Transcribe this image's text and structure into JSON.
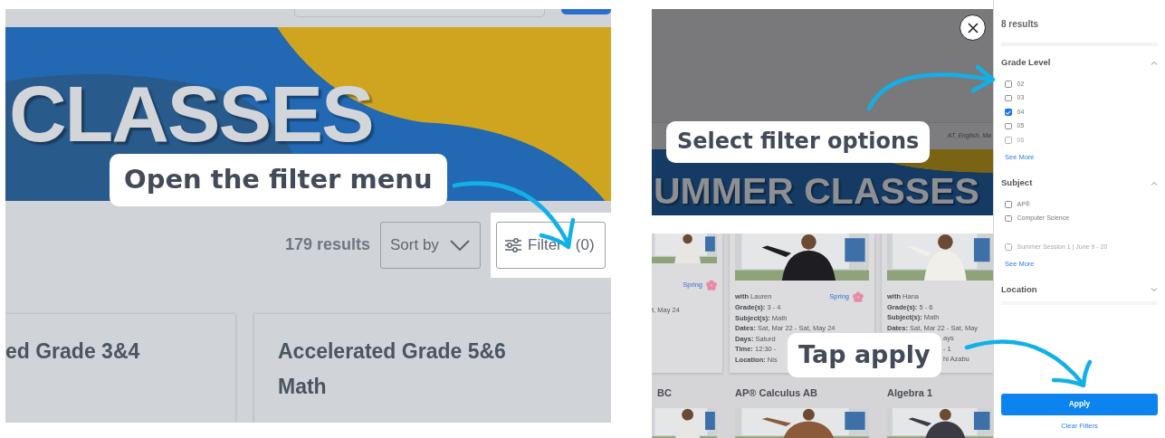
{
  "step_1": {
    "callout": "Open the filter menu",
    "banner_title": "CLASSES",
    "results_count": "179 results",
    "sort_button": "Sort by",
    "filter_button": {
      "label": "Filter",
      "count": "(0)",
      "highlighted": true
    },
    "cards": [
      {
        "title": "ed Grade 3&4"
      },
      {
        "title": "Accelerated Grade 5&6 Math"
      }
    ]
  },
  "step_2": {
    "callout": "Select filter options",
    "search_hint": "AT, English, Ma",
    "banner_title": "UMMER CLASSES"
  },
  "step_3": {
    "callout": "Tap apply",
    "cards": [
      {
        "season": "Spring",
        "lines": [
          "t, May 24"
        ]
      },
      {
        "season": "Spring",
        "lines": [
          "**with** Lauren",
          "**Grade(s):** 3 - 4",
          "**Subject(s):** Math",
          "**Dates:** Sat, Mar 22 - Sat, May 24",
          "**Days:** Saturd",
          "**Time:** 12:30 -",
          "**Location:** Nis"
        ]
      },
      {
        "lines": [
          "**with** Hana",
          "**Grade(s):** 5 - 6",
          "**Subject(s):** Math",
          "**Dates:** Sat, Mar 22 - Sat, May",
          "ays",
          "- 1",
          "hi Azabu"
        ]
      }
    ],
    "next_titles": [
      "BC",
      "AP® Calculus AB",
      "Algebra 1"
    ]
  },
  "filter_panel": {
    "results": "8 results",
    "sections": [
      {
        "title": "Grade Level",
        "expanded": true,
        "options": [
          {
            "label": "02",
            "checked": false,
            "faded": false
          },
          {
            "label": "03",
            "checked": false,
            "faded": false
          },
          {
            "label": "04",
            "checked": true,
            "faded": false
          },
          {
            "label": "05",
            "checked": false,
            "faded": false
          },
          {
            "label": "06",
            "checked": false,
            "faded": true
          }
        ],
        "see_more": "See More"
      },
      {
        "title": "Subject",
        "expanded": true,
        "options": [
          {
            "label": "AP®",
            "checked": false,
            "faded": false
          },
          {
            "label": "Computer Science",
            "checked": false,
            "faded": false
          },
          {
            "label": "Summer Session 1 | June 9 - 20",
            "checked": false,
            "faded": true
          }
        ],
        "see_more": "See More"
      },
      {
        "title": "Location",
        "expanded": false
      }
    ],
    "apply": "Apply",
    "clear": "Clear Filters"
  }
}
